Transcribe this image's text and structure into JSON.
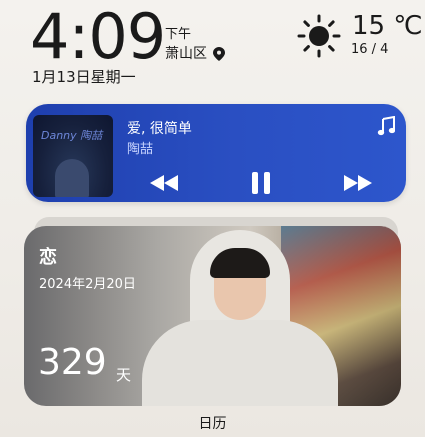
{
  "clock": {
    "time": "4:09",
    "ampm": "下午",
    "district": "萧山区",
    "date": "1月13日星期一"
  },
  "weather": {
    "icon": "sun-icon",
    "temperature": "15 ℃",
    "range": "16 / 4"
  },
  "music": {
    "song": "爱, 很简单",
    "artist": "陶喆",
    "album_art_text": "Danny 陶喆",
    "accent": "#2a4fc2",
    "controls": [
      "previous-icon",
      "pause-icon",
      "next-icon"
    ]
  },
  "photo_widget": {
    "title": "恋",
    "start_date": "2024年2月20日",
    "days_count": "329",
    "days_unit": "天",
    "caption": "日历"
  }
}
